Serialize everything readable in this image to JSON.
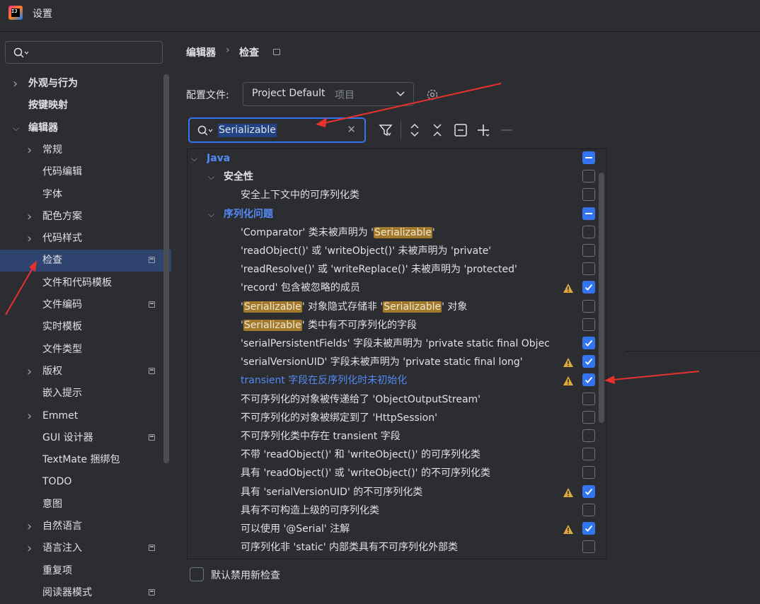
{
  "window": {
    "title": "设置"
  },
  "sidebar": {
    "search_placeholder": "",
    "items": [
      {
        "label": "外观与行为",
        "chevron": true,
        "bold": true,
        "level": 0
      },
      {
        "label": "按键映射",
        "chevron": false,
        "bold": true,
        "level": 0
      },
      {
        "label": "编辑器",
        "chevron": "open",
        "bold": true,
        "level": 0
      },
      {
        "label": "常规",
        "chevron": true,
        "level": 1
      },
      {
        "label": "代码编辑",
        "level": 1
      },
      {
        "label": "字体",
        "level": 1
      },
      {
        "label": "配色方案",
        "chevron": true,
        "level": 1
      },
      {
        "label": "代码样式",
        "chevron": true,
        "level": 1
      },
      {
        "label": "检查",
        "level": 1,
        "selected": true,
        "page_icon": true
      },
      {
        "label": "文件和代码模板",
        "level": 1
      },
      {
        "label": "文件编码",
        "level": 1,
        "page_icon": true
      },
      {
        "label": "实时模板",
        "level": 1
      },
      {
        "label": "文件类型",
        "level": 1
      },
      {
        "label": "版权",
        "chevron": true,
        "level": 1,
        "page_icon": true
      },
      {
        "label": "嵌入提示",
        "level": 1
      },
      {
        "label": "Emmet",
        "chevron": true,
        "level": 1
      },
      {
        "label": "GUI 设计器",
        "level": 1,
        "page_icon": true
      },
      {
        "label": "TextMate 捆绑包",
        "level": 1
      },
      {
        "label": "TODO",
        "level": 1
      },
      {
        "label": "意图",
        "level": 1
      },
      {
        "label": "自然语言",
        "chevron": true,
        "level": 1
      },
      {
        "label": "语言注入",
        "chevron": true,
        "level": 1,
        "page_icon": true
      },
      {
        "label": "重复项",
        "level": 1
      },
      {
        "label": "阅读器模式",
        "level": 1,
        "page_icon": true
      }
    ]
  },
  "breadcrumb": {
    "parent": "编辑器",
    "separator": "›",
    "current": "检查"
  },
  "profile": {
    "label": "配置文件:",
    "value": "Project Default",
    "scope": "项目"
  },
  "filter": {
    "value": "Serializable"
  },
  "inspections": [
    {
      "parts": [
        {
          "t": "Java"
        }
      ],
      "style": "blue",
      "indent": 0,
      "chevron": "open",
      "state": "partial"
    },
    {
      "parts": [
        {
          "t": "安全性"
        }
      ],
      "style": "bold",
      "indent": 1,
      "chevron": "open",
      "state": "unchecked"
    },
    {
      "parts": [
        {
          "t": "安全上下文中的可序列化类"
        }
      ],
      "indent": 2,
      "state": "unchecked"
    },
    {
      "parts": [
        {
          "t": "序列化问题"
        }
      ],
      "style": "blue",
      "indent": 1,
      "chevron": "open",
      "state": "partial"
    },
    {
      "parts": [
        {
          "t": "'Comparator' 类未被声明为 '"
        },
        {
          "t": "Serializable",
          "hl": true
        },
        {
          "t": "'"
        }
      ],
      "indent": 2,
      "state": "unchecked"
    },
    {
      "parts": [
        {
          "t": "'readObject()' 或 'writeObject()' 未被声明为 'private'"
        }
      ],
      "indent": 2,
      "state": "unchecked"
    },
    {
      "parts": [
        {
          "t": "'readResolve()' 或 'writeReplace()' 未被声明为 'protected'"
        }
      ],
      "indent": 2,
      "state": "unchecked"
    },
    {
      "parts": [
        {
          "t": "'record' 包含被忽略的成员"
        }
      ],
      "indent": 2,
      "state": "checked",
      "warn": true
    },
    {
      "parts": [
        {
          "t": "'"
        },
        {
          "t": "Serializable",
          "hl": true
        },
        {
          "t": "' 对象隐式存储非 '"
        },
        {
          "t": "Serializable",
          "hl": true
        },
        {
          "t": "' 对象"
        }
      ],
      "indent": 2,
      "state": "unchecked"
    },
    {
      "parts": [
        {
          "t": "'"
        },
        {
          "t": "Serializable",
          "hl": true
        },
        {
          "t": "' 类中有不可序列化的字段"
        }
      ],
      "indent": 2,
      "state": "unchecked"
    },
    {
      "parts": [
        {
          "t": "'serialPersistentFields' 字段未被声明为 'private static final Objec"
        }
      ],
      "indent": 2,
      "state": "checked"
    },
    {
      "parts": [
        {
          "t": "'serialVersionUID' 字段未被声明为 'private static final long'"
        }
      ],
      "indent": 2,
      "state": "checked",
      "warn": true
    },
    {
      "parts": [
        {
          "t": "transient 字段在反序列化时未初始化"
        }
      ],
      "style": "link",
      "indent": 2,
      "state": "checked",
      "warn": true
    },
    {
      "parts": [
        {
          "t": "不可序列化的对象被传递给了 'ObjectOutputStream'"
        }
      ],
      "indent": 2,
      "state": "unchecked"
    },
    {
      "parts": [
        {
          "t": "不可序列化的对象被绑定到了 'HttpSession'"
        }
      ],
      "indent": 2,
      "state": "unchecked"
    },
    {
      "parts": [
        {
          "t": "不可序列化类中存在 transient 字段"
        }
      ],
      "indent": 2,
      "state": "unchecked"
    },
    {
      "parts": [
        {
          "t": "不带 'readObject()' 和 'writeObject()' 的可序列化类"
        }
      ],
      "indent": 2,
      "state": "unchecked"
    },
    {
      "parts": [
        {
          "t": "具有 'readObject()' 或 'writeObject()' 的不可序列化类"
        }
      ],
      "indent": 2,
      "state": "unchecked"
    },
    {
      "parts": [
        {
          "t": "具有 'serialVersionUID' 的不可序列化类"
        }
      ],
      "indent": 2,
      "state": "checked",
      "warn": true
    },
    {
      "parts": [
        {
          "t": "具有不可构造上级的可序列化类"
        }
      ],
      "indent": 2,
      "state": "unchecked"
    },
    {
      "parts": [
        {
          "t": "可以使用 '@Serial' 注解"
        }
      ],
      "indent": 2,
      "state": "checked",
      "warn": true
    },
    {
      "parts": [
        {
          "t": "可序列化非 'static' 内部类具有不可序列化外部类"
        }
      ],
      "indent": 2,
      "state": "unchecked"
    }
  ],
  "default_disable": {
    "label": "默认禁用新检查",
    "checked": false
  },
  "colors": {
    "accent": "#3574f0",
    "highlight": "#a37a2c",
    "annotation_arrow": "#e8312f",
    "warning": "#e0a93a"
  }
}
